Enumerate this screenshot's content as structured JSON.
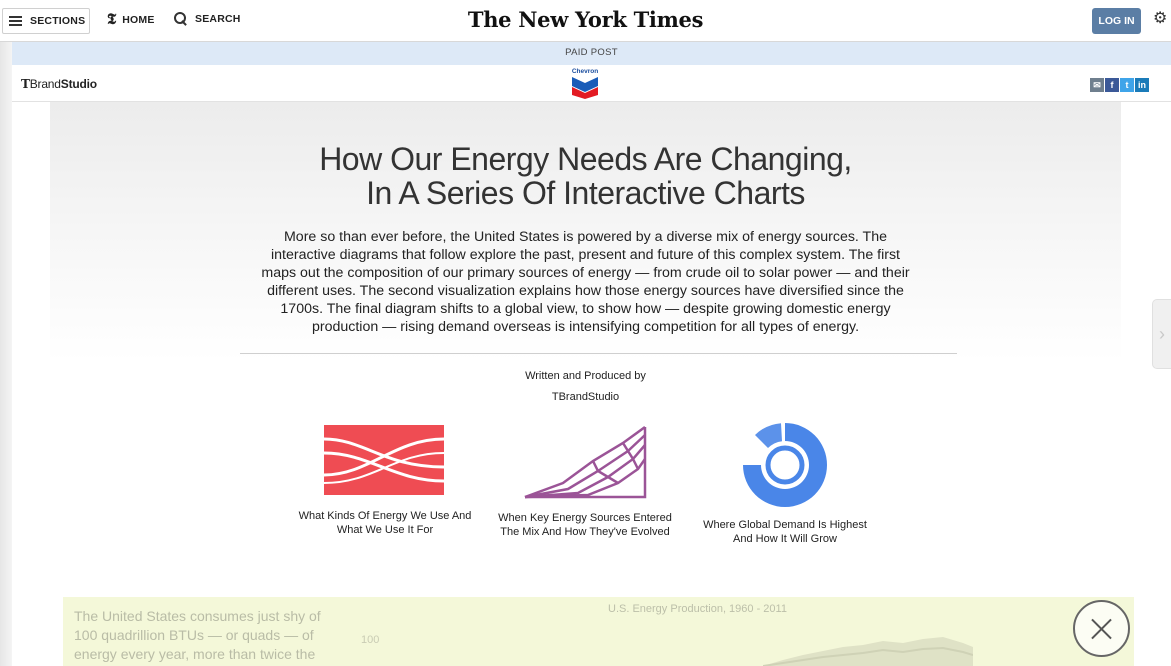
{
  "nav": {
    "sections_label": "SECTIONS",
    "home_label": "HOME",
    "search_label": "SEARCH",
    "masthead": "The New York Times",
    "login_label": "LOG IN"
  },
  "paid_post": "PAID POST",
  "brand": {
    "tbrand_prefix": "T",
    "tbrand_regular": "Brand",
    "tbrand_bold": "Studio",
    "sponsor": "Chevron"
  },
  "article": {
    "headline_line1": "How Our Energy Needs Are Changing,",
    "headline_line2": "In A Series Of Interactive Charts",
    "intro": "More so than ever before, the United States is powered by a diverse mix of energy sources. The interactive diagrams that follow explore the past, present and future of this complex system. The first maps out the composition of our primary sources of energy — from crude oil to solar power — and their different uses. The second visualization explains how those energy sources have diversified since the 1700s. The final diagram shifts to a global view, to show how — despite growing domestic energy production — rising demand overseas is intensifying competition for all types of energy.",
    "credit_label": "Written and Produced by",
    "credit_name": "TBrandStudio"
  },
  "cards": [
    {
      "line1": "What Kinds Of Energy We Use And",
      "line2": "What We Use It For",
      "color": "#ef4c53"
    },
    {
      "line1": "When Key Energy Sources Entered",
      "line2": "The Mix And How They've Evolved",
      "color": "#9b5497"
    },
    {
      "line1": "Where Global Demand Is Highest",
      "line2": "And How It Will Grow",
      "color": "#4a86e8"
    }
  ],
  "preview": {
    "text": "The United States consumes just shy of 100 quadrillion BTUs — or quads — of energy every year, more than twice the",
    "chart_title": "U.S. Energy Production, 1960 - 2011",
    "tick": "100"
  },
  "icons": {
    "menu": "hamburger-icon",
    "home": "nyt-t-icon",
    "search": "search-icon",
    "settings": "gear-icon",
    "mail": "mail-icon",
    "facebook": "facebook-icon",
    "twitter": "twitter-icon",
    "linkedin": "linkedin-icon",
    "close": "close-icon"
  },
  "colors": {
    "login": "#5b7ea5",
    "paid_bar": "#dde9f7",
    "preview_bg": "#f4f8d9"
  }
}
